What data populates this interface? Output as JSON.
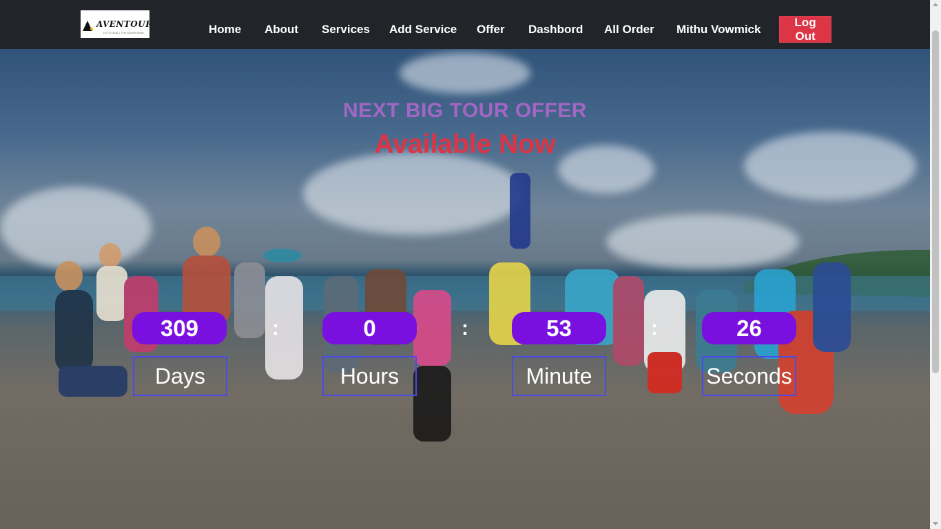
{
  "brand": {
    "name": "AVENTOURA",
    "tagline": "LET'S DEAL | THE ADVENTURE"
  },
  "nav": {
    "items": [
      {
        "label": "Home"
      },
      {
        "label": "About"
      },
      {
        "label": "Services"
      },
      {
        "label": "Add Service"
      },
      {
        "label": "Offer"
      },
      {
        "label": "Dashbord"
      },
      {
        "label": "All Order"
      },
      {
        "label": "Mithu Vowmick"
      }
    ],
    "logout_label": "Log Out"
  },
  "hero": {
    "title": "NEXT BIG TOUR OFFER",
    "subtitle": "Available Now",
    "separator": ":",
    "countdown": [
      {
        "value": "309",
        "unit": "Days"
      },
      {
        "value": "0",
        "unit": "Hours"
      },
      {
        "value": "53",
        "unit": "Minute"
      },
      {
        "value": "26",
        "unit": "Seconds"
      }
    ]
  },
  "colors": {
    "navbar_bg": "#212529",
    "logout_bg": "#dc3545",
    "title_color": "#a266c4",
    "subtitle_color": "#dc3545",
    "counter_bg": "#7a10e0",
    "unit_border": "#4b4be8"
  }
}
